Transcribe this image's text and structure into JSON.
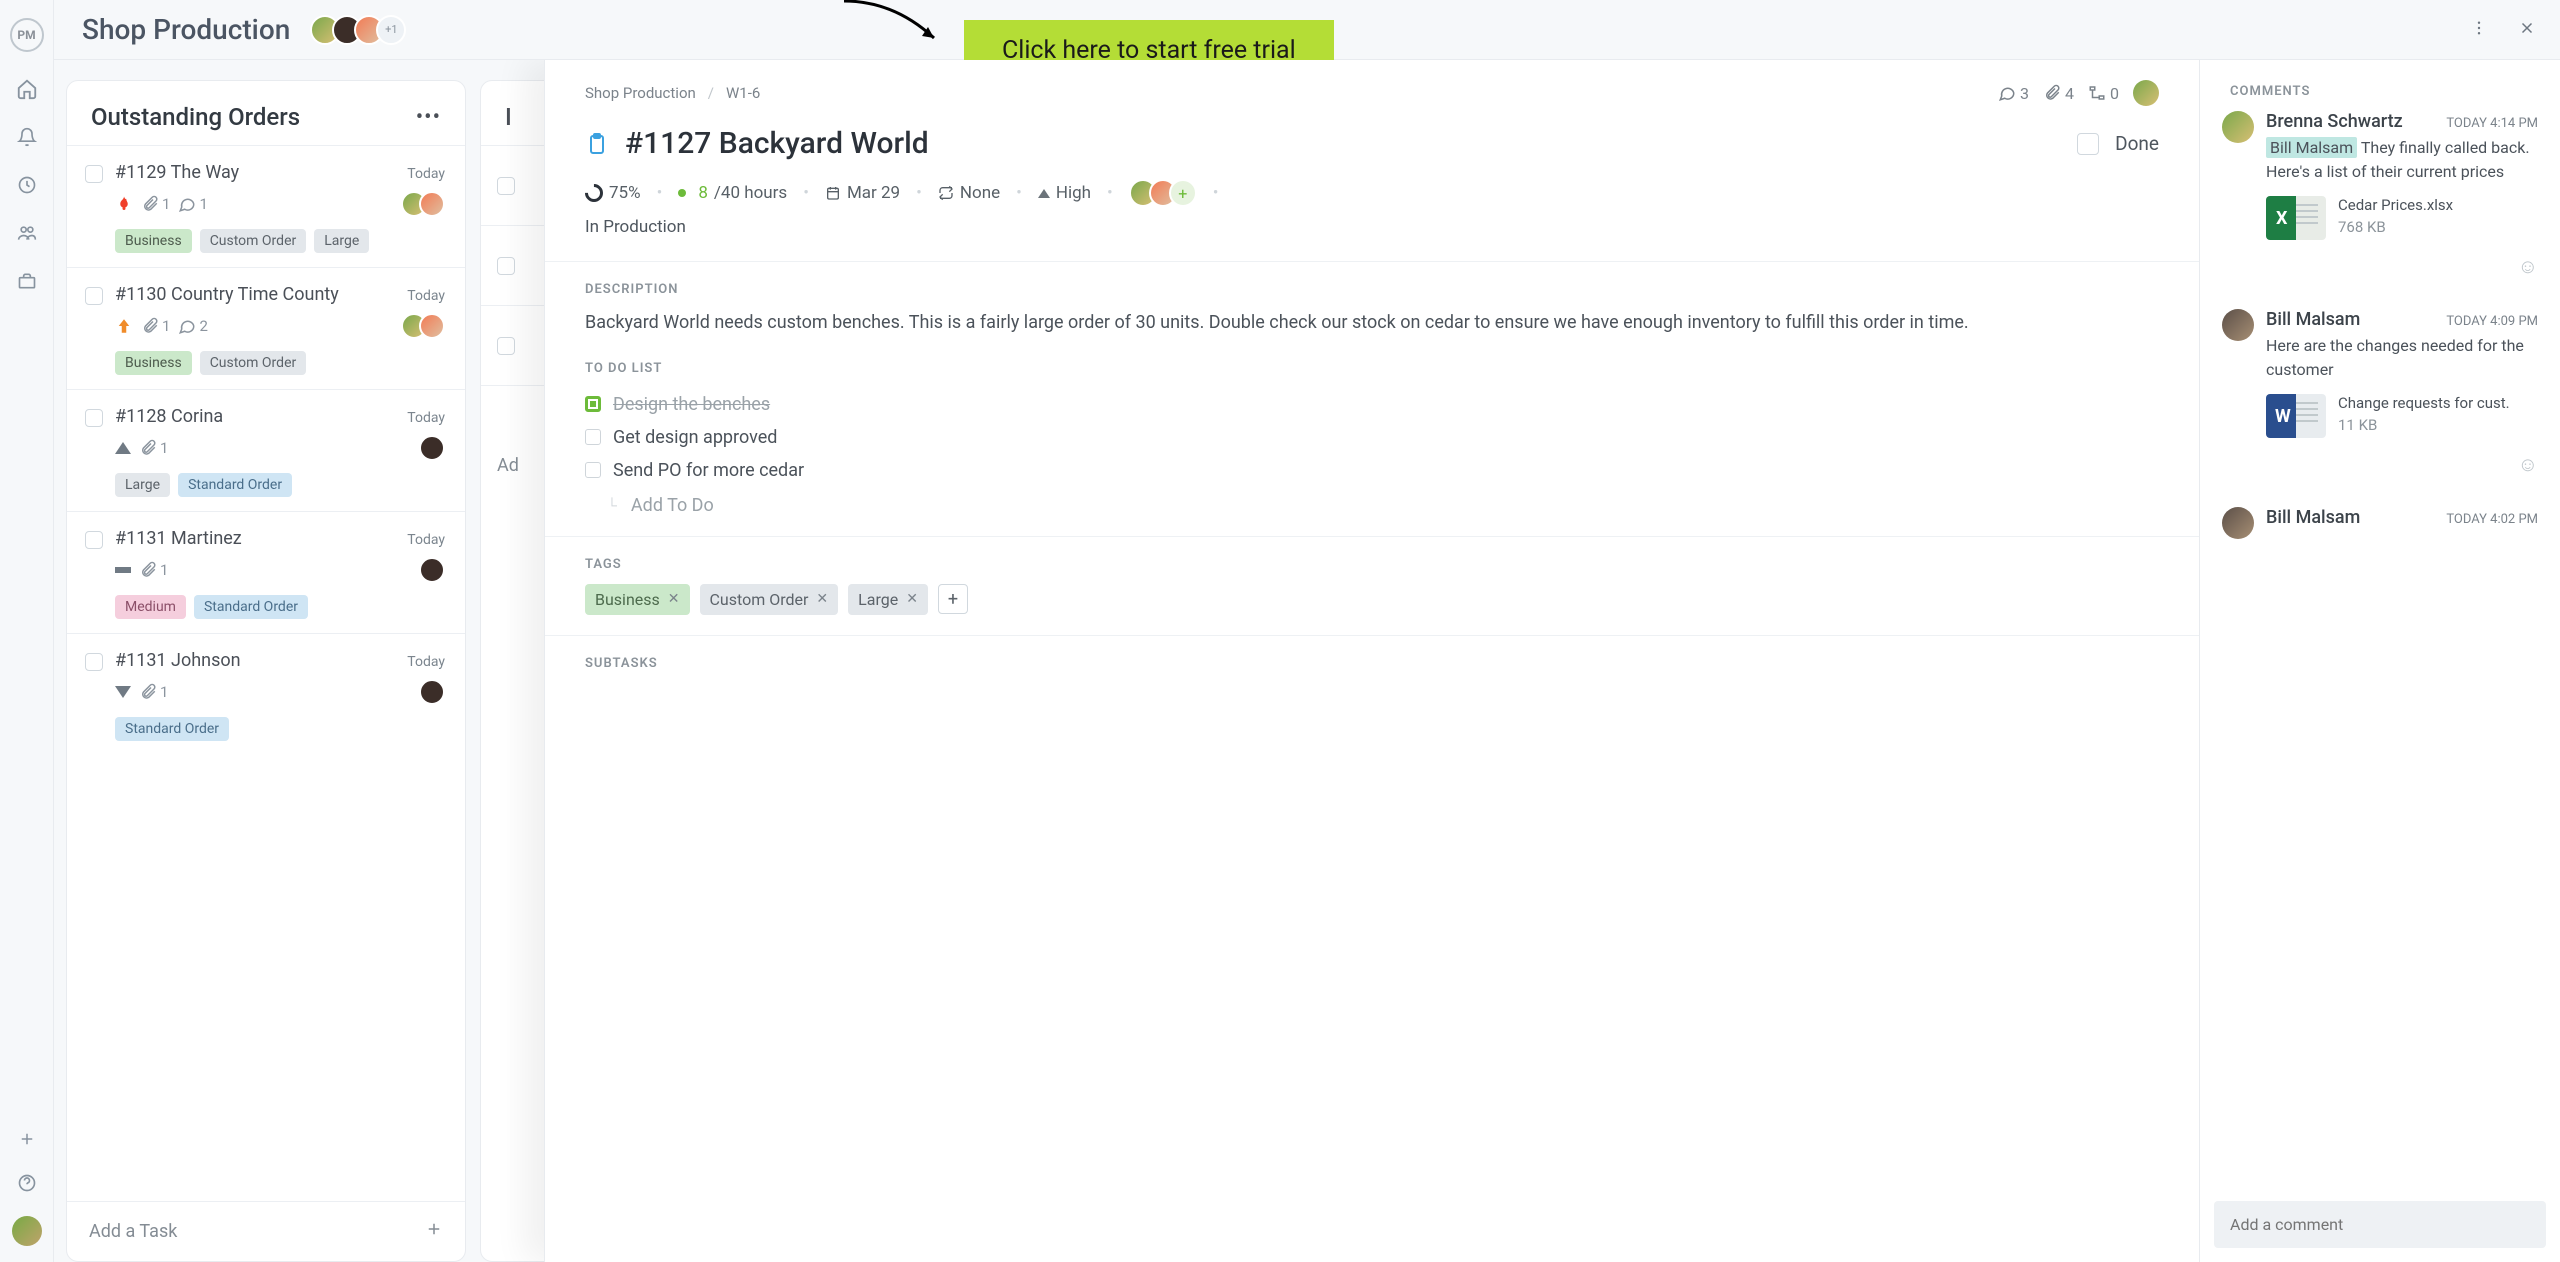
{
  "header": {
    "title": "Shop Production",
    "avatars_more": "+1",
    "cta": "Click here to start free trial"
  },
  "column1": {
    "title": "Outstanding Orders"
  },
  "cards": [
    {
      "title": "#1129 The Way",
      "date": "Today",
      "attach": "1",
      "comments": "1",
      "tags": [
        {
          "label": "Business",
          "cls": "green"
        },
        {
          "label": "Custom Order",
          "cls": "gray"
        },
        {
          "label": "Large",
          "cls": "gray"
        }
      ],
      "priority": "flame",
      "multi": true
    },
    {
      "title": "#1130 Country Time County",
      "date": "Today",
      "attach": "1",
      "comments": "2",
      "tags": [
        {
          "label": "Business",
          "cls": "green"
        },
        {
          "label": "Custom Order",
          "cls": "gray"
        }
      ],
      "priority": "orange-up",
      "multi": true
    },
    {
      "title": "#1128 Corina",
      "date": "Today",
      "attach": "1",
      "tags": [
        {
          "label": "Large",
          "cls": "gray"
        },
        {
          "label": "Standard Order",
          "cls": "blue"
        }
      ],
      "priority": "tri-up"
    },
    {
      "title": "#1131 Martinez",
      "date": "Today",
      "attach": "1",
      "tags": [
        {
          "label": "Medium",
          "cls": "pink"
        },
        {
          "label": "Standard Order",
          "cls": "blue"
        }
      ],
      "priority": "bar-mid"
    },
    {
      "title": "#1131 Johnson",
      "date": "Today",
      "attach": "1",
      "tags": [
        {
          "label": "Standard Order",
          "cls": "blue"
        }
      ],
      "priority": "tri-down"
    }
  ],
  "add_task": "Add a Task",
  "col2": {
    "add": "Ad"
  },
  "panel": {
    "crumb_project": "Shop Production",
    "crumb_sep": "/",
    "crumb_item": "W1-6",
    "counts": {
      "comments": "3",
      "attachments": "4",
      "subtasks": "0"
    },
    "title": "#1127 Backyard World",
    "done": "Done",
    "progress": "75%",
    "hours_used": "8",
    "hours_total": "/40 hours",
    "due": "Mar 29",
    "recurrence": "None",
    "priority": "High",
    "status": "In Production",
    "description_label": "DESCRIPTION",
    "description": "Backyard World needs custom benches. This is a fairly large order of 30 units. Double check our stock on cedar to ensure we have enough inventory to fulfill this order in time.",
    "todo_label": "TO DO LIST",
    "todos": [
      {
        "label": "Design the benches",
        "done": true
      },
      {
        "label": "Get design approved",
        "done": false
      },
      {
        "label": "Send PO for more cedar",
        "done": false
      }
    ],
    "add_todo": "Add To Do",
    "tags_label": "TAGS",
    "tags": [
      {
        "label": "Business",
        "cls": "green"
      },
      {
        "label": "Custom Order",
        "cls": "gray"
      },
      {
        "label": "Large",
        "cls": "gray"
      }
    ],
    "subtasks_label": "SUBTASKS"
  },
  "comments": {
    "header": "COMMENTS",
    "items": [
      {
        "author": "Brenna Schwartz",
        "avatar": "brenna",
        "time": "TODAY 4:14 PM",
        "mention": "Bill Malsam",
        "text": " They finally called back. Here's a list of their current prices",
        "file": {
          "name": "Cedar Prices.xlsx",
          "size": "768 KB",
          "type": "xls"
        }
      },
      {
        "author": "Bill Malsam",
        "avatar": "bill",
        "time": "TODAY 4:09 PM",
        "text": "Here are the changes needed for the customer",
        "file": {
          "name": "Change requests for cust.",
          "size": "11 KB",
          "type": "doc"
        }
      },
      {
        "author": "Bill Malsam",
        "avatar": "bill",
        "time": "TODAY 4:02 PM",
        "text": ""
      }
    ],
    "placeholder": "Add a comment"
  }
}
